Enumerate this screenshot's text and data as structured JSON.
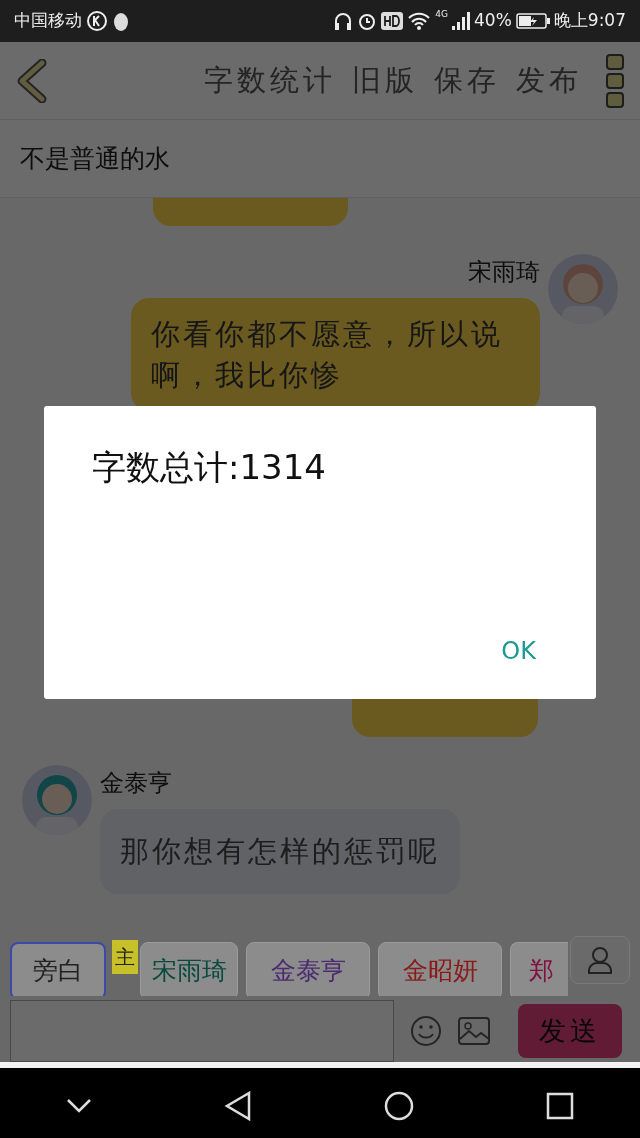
{
  "status_bar": {
    "carrier": "中国移动",
    "network": "4G",
    "battery": "40%",
    "time": "晚上9:07"
  },
  "toolbar": {
    "actions": [
      "字数统计",
      "旧版",
      "保存",
      "发布"
    ]
  },
  "title": "不是普通的水",
  "messages": [
    {
      "kind": "fragment"
    },
    {
      "kind": "outgoing",
      "name": "宋雨琦",
      "text": "你看你都不愿意，所以说啊，我比你惨"
    },
    {
      "kind": "gap"
    },
    {
      "kind": "fragment"
    },
    {
      "kind": "incoming",
      "name": "金泰亨",
      "text": "那你想有怎样的惩罚呢"
    }
  ],
  "characters": [
    {
      "label": "旁白",
      "selected": true,
      "color": "#222222"
    },
    {
      "label": "宋雨琦",
      "selected": false,
      "color": "#0a4a3c",
      "tag": "主"
    },
    {
      "label": "金泰亨",
      "selected": false,
      "color": "#4a2a70"
    },
    {
      "label": "金昭妍",
      "selected": false,
      "color": "#8a1a1a"
    },
    {
      "label": "郑",
      "selected": false,
      "color": "#801040"
    }
  ],
  "send_button": "发送",
  "dialog": {
    "message": "字数总计:1314",
    "button": "OK"
  }
}
